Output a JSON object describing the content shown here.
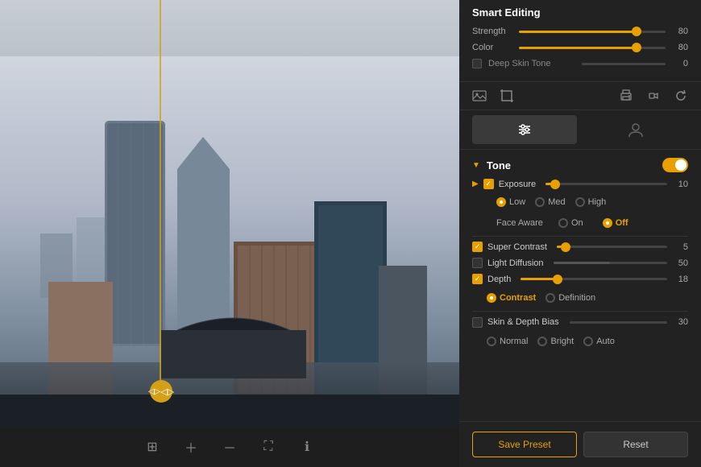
{
  "header": {
    "title": "Smart Editing"
  },
  "smart_editing": {
    "strength_label": "Strength",
    "strength_value": "80",
    "strength_pct": 80,
    "color_label": "Color",
    "color_value": "80",
    "color_pct": 80,
    "deep_skin_label": "Deep Skin Tone",
    "deep_skin_value": "0"
  },
  "tabs": {
    "adjustments_label": "⚙",
    "portrait_label": "👤"
  },
  "tone": {
    "title": "Tone",
    "exposure_label": "Exposure",
    "exposure_value": "10",
    "exposure_pct": 8,
    "low_label": "Low",
    "med_label": "Med",
    "high_label": "High",
    "face_aware_label": "Face Aware",
    "on_label": "On",
    "off_label": "Off",
    "super_contrast_label": "Super Contrast",
    "super_contrast_value": "5",
    "super_contrast_pct": 8,
    "light_diffusion_label": "Light Diffusion",
    "light_diffusion_value": "50",
    "light_diffusion_pct": 50,
    "depth_label": "Depth",
    "depth_value": "18",
    "depth_pct": 25,
    "contrast_label": "Contrast",
    "definition_label": "Definition",
    "skin_depth_label": "Skin & Depth Bias",
    "skin_depth_value": "30",
    "skin_depth_pct": 30,
    "normal_label": "Normal",
    "bright_label": "Bright",
    "auto_label": "Auto"
  },
  "buttons": {
    "save_preset": "Save Preset",
    "reset": "Reset"
  },
  "icons": {
    "image": "🖼",
    "crop": "✂",
    "print": "🖨",
    "audio": "🔊",
    "refresh": "↻"
  }
}
